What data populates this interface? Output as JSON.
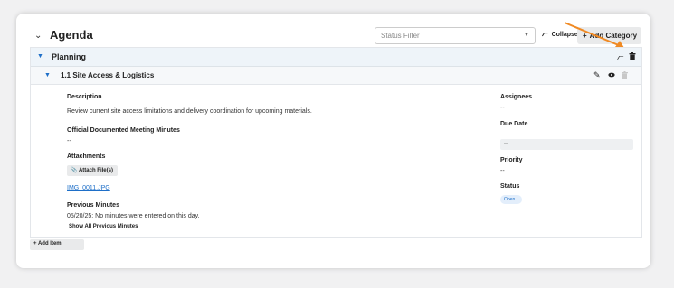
{
  "agenda": {
    "title": "Agenda",
    "status_filter_placeholder": "Status Filter",
    "collapse_all_label": "Collapse All",
    "add_category_label": "Add Category"
  },
  "category": {
    "label": "Planning"
  },
  "item": {
    "label": "1.1 Site Access & Logistics",
    "description_label": "Description",
    "description_value": "Review current site access limitations and delivery coordination for upcoming materials.",
    "minutes_label": "Official Documented Meeting Minutes",
    "minutes_value": "--",
    "attachments_label": "Attachments",
    "attach_button_label": "Attach File(s)",
    "attachment_file": "IMG_0011.JPG",
    "previous_minutes_label": "Previous Minutes",
    "previous_minutes_value": "05/20/25:  No minutes were entered on this day.",
    "show_previous_label": "Show All Previous Minutes",
    "assignees_label": "Assignees",
    "assignees_value": "--",
    "due_date_label": "Due Date",
    "due_date_value": "--",
    "priority_label": "Priority",
    "priority_value": "--",
    "status_label": "Status",
    "status_value": "Open"
  },
  "add_item_label": "+ Add Item",
  "colors": {
    "accent": "#1e6fc8",
    "annotation_arrow": "#f08a24"
  }
}
